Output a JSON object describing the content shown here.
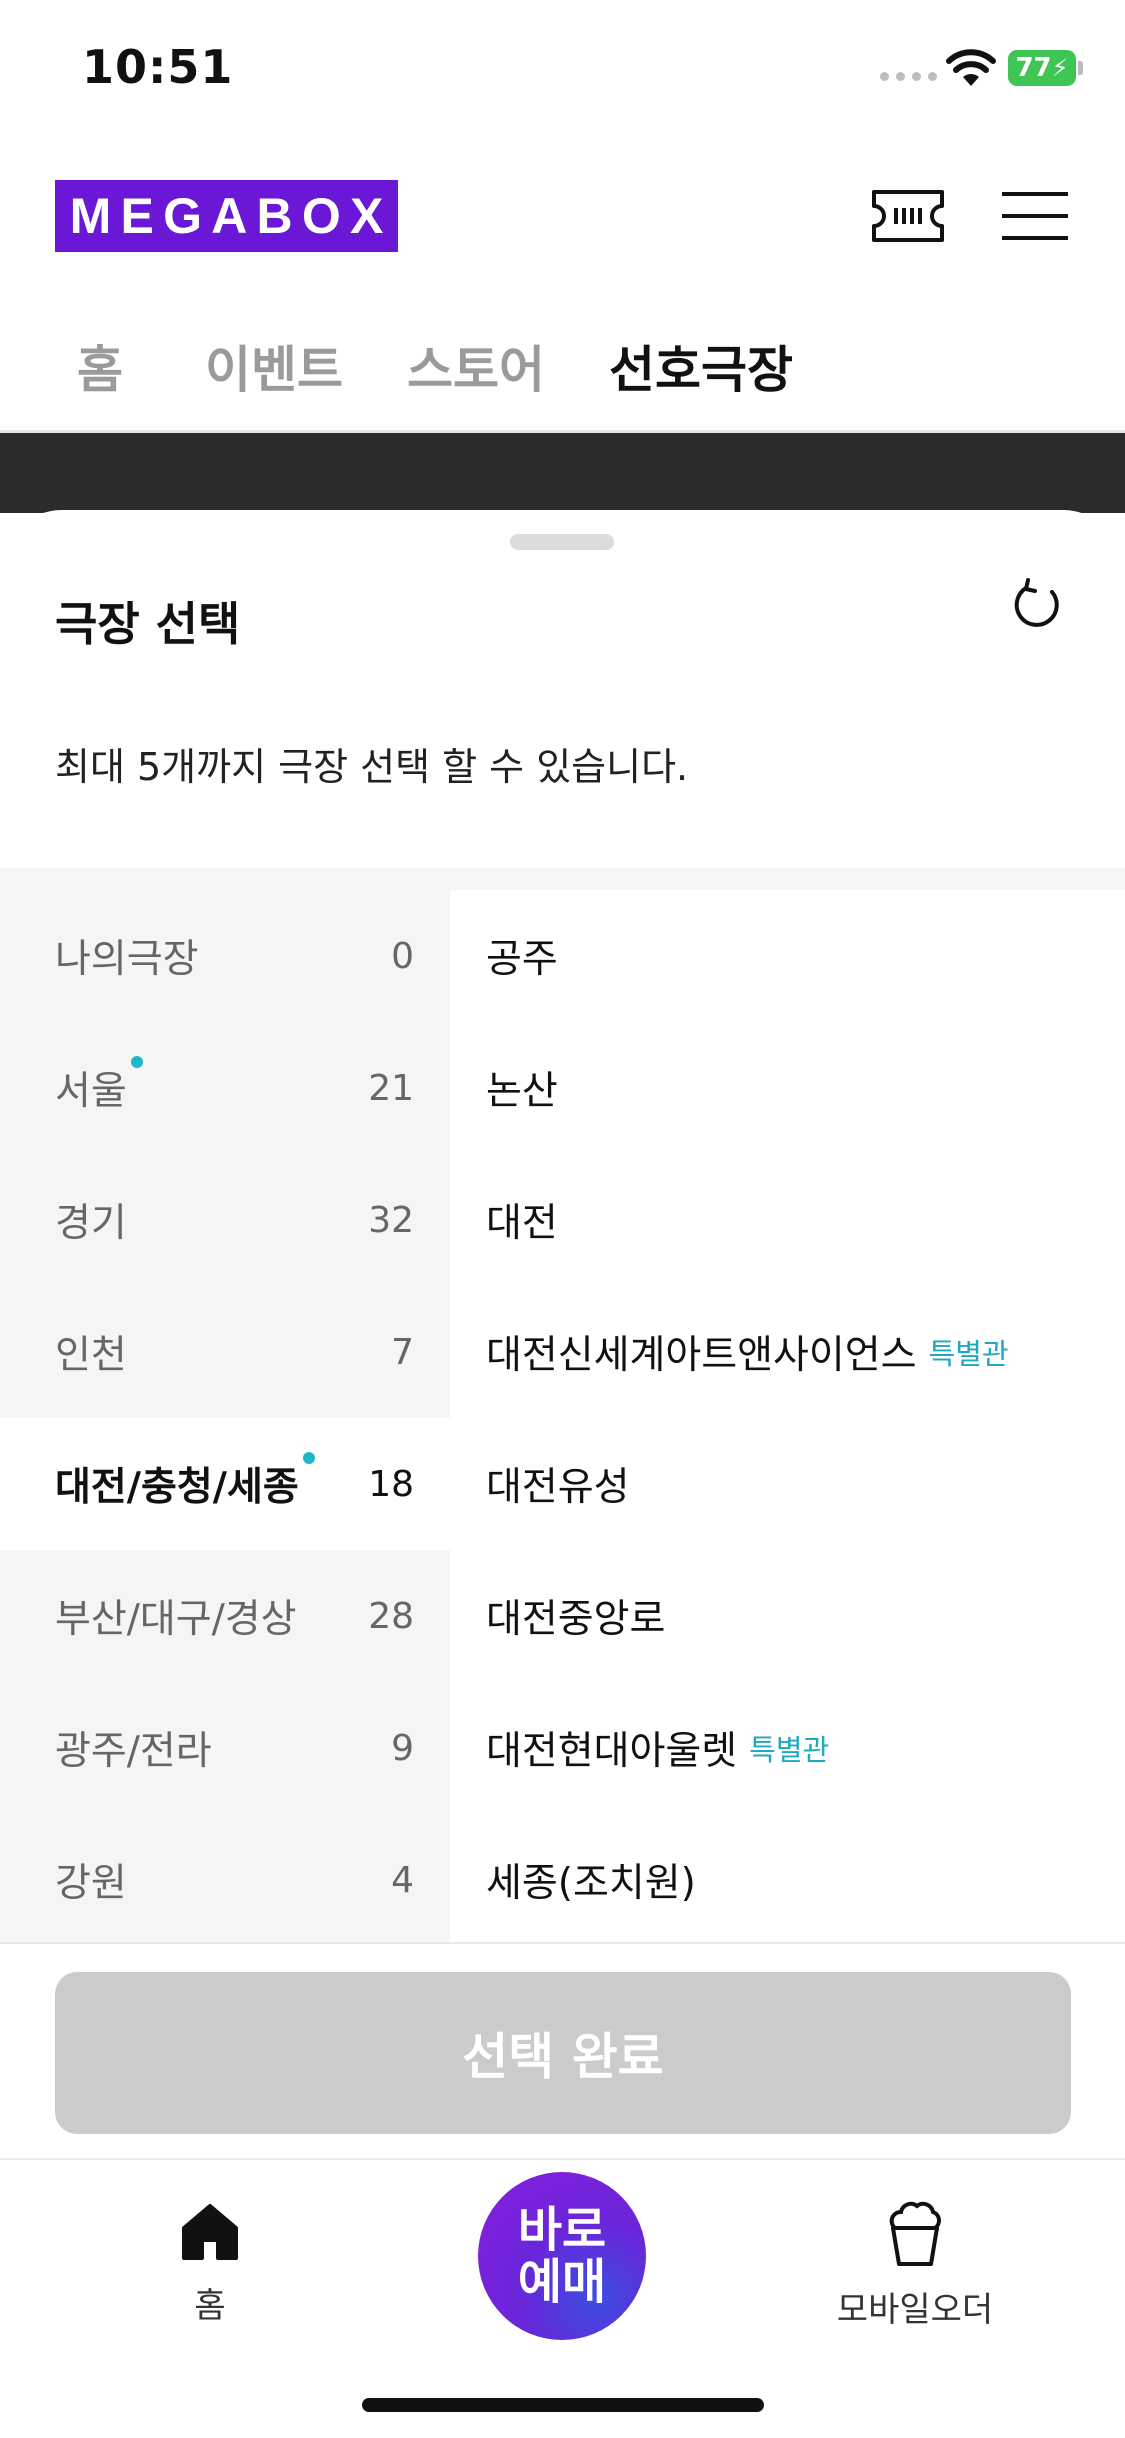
{
  "status": {
    "time": "10:51",
    "battery": "77"
  },
  "header": {
    "logo_letters": [
      "M",
      "E",
      "G",
      "A",
      "B",
      "O",
      "X"
    ],
    "tabs": [
      "홈",
      "이벤트",
      "스토어",
      "선호극장"
    ],
    "active_tab": "선호극장"
  },
  "sheet": {
    "title": "극장 선택",
    "notice": "최대 5개까지 극장 선택 할 수 있습니다.",
    "regions": [
      {
        "name": "나의극장",
        "count": "0"
      },
      {
        "name": "서울",
        "count": "21"
      },
      {
        "name": "경기",
        "count": "32"
      },
      {
        "name": "인천",
        "count": "7"
      },
      {
        "name": "대전/충청/세종",
        "count": "18"
      },
      {
        "name": "부산/대구/경상",
        "count": "28"
      },
      {
        "name": "광주/전라",
        "count": "9"
      },
      {
        "name": "강원",
        "count": "4"
      }
    ],
    "theaters": [
      {
        "name": "공주"
      },
      {
        "name": "논산"
      },
      {
        "name": "대전"
      },
      {
        "name": "대전신세계아트앤사이언스",
        "badge": "특별관"
      },
      {
        "name": "대전유성"
      },
      {
        "name": "대전중앙로"
      },
      {
        "name": "대전현대아울렛",
        "badge": "특별관"
      },
      {
        "name": "세종(조치원)"
      }
    ],
    "confirm_label": "선택 완료"
  },
  "tabbar": {
    "home_label": "홈",
    "book_line1": "바로",
    "book_line2": "예매",
    "order_label": "모바일오더"
  },
  "colors": {
    "brand": "#6a17d6",
    "accent": "#1fb6c9",
    "disabled": "#cbcbcb"
  }
}
